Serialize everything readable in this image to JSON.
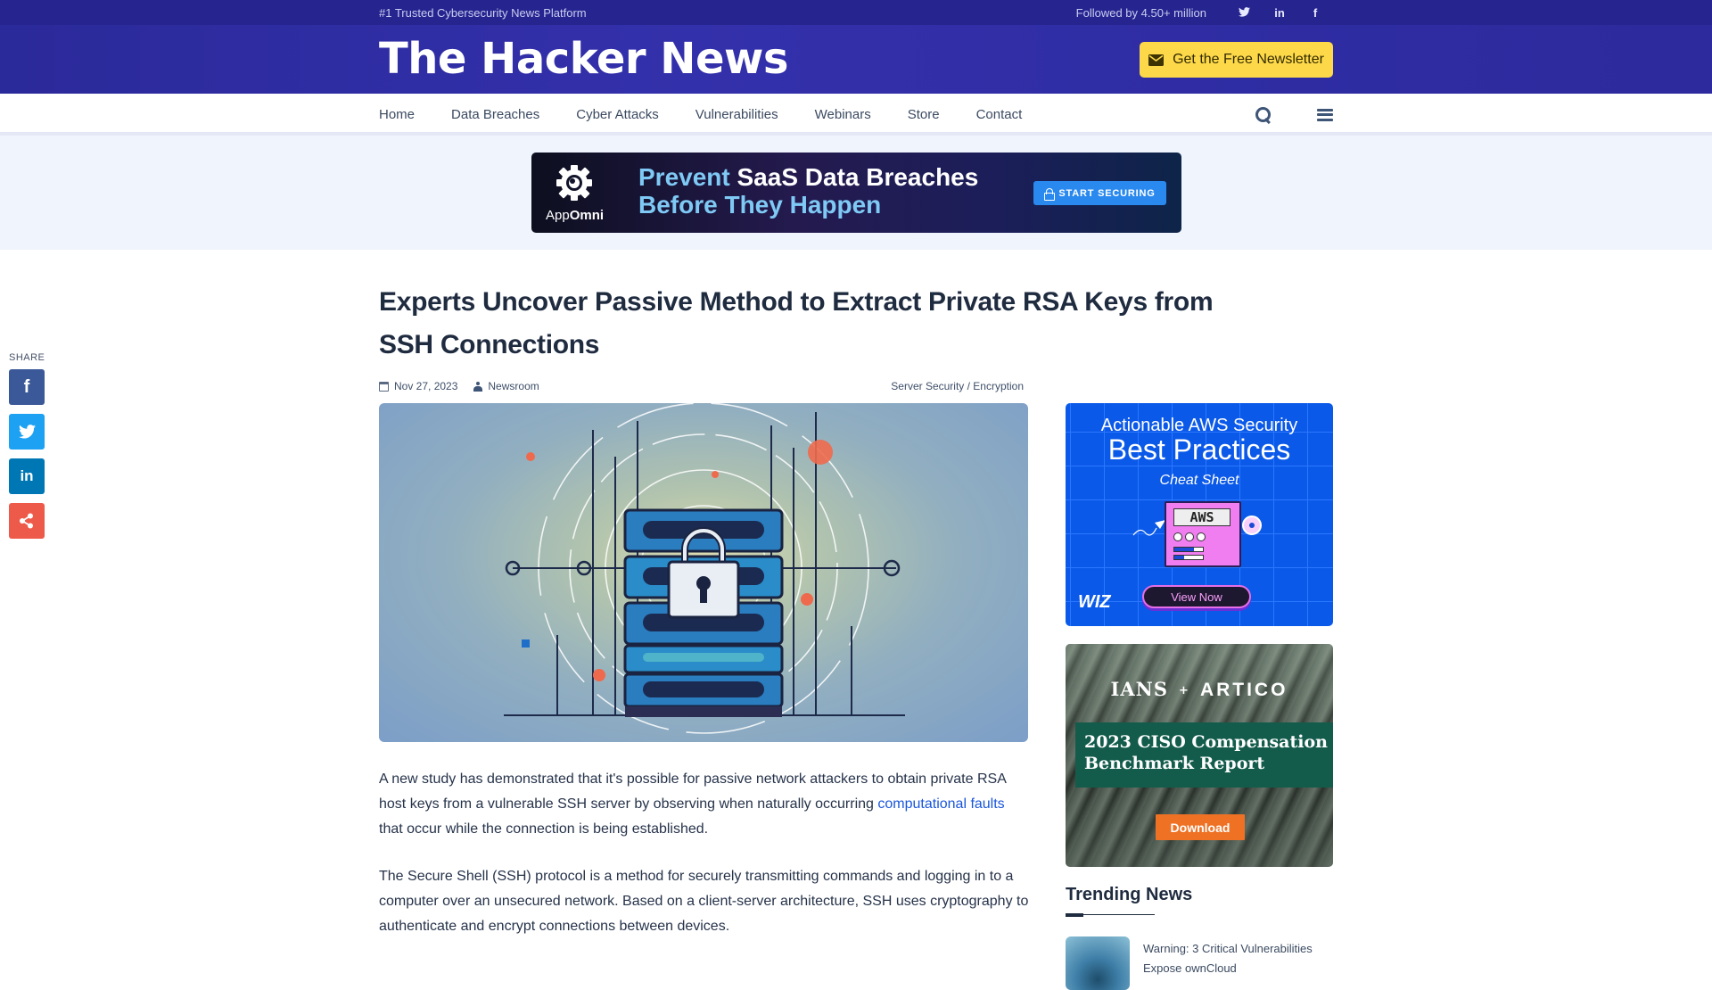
{
  "topbar": {
    "tagline": "#1 Trusted Cybersecurity News Platform",
    "followed": "Followed by 4.50+ million",
    "social": [
      {
        "name": "twitter-icon",
        "glyph": "🐦"
      },
      {
        "name": "linkedin-icon",
        "glyph": "in"
      },
      {
        "name": "facebook-icon",
        "glyph": "f"
      }
    ]
  },
  "header": {
    "logo": "The Hacker News",
    "newsletter_label": "Get the Free Newsletter"
  },
  "nav": {
    "items": [
      "Home",
      "Data Breaches",
      "Cyber Attacks",
      "Vulnerabilities",
      "Webinars",
      "Store",
      "Contact"
    ]
  },
  "top_ad": {
    "brand_prefix": "App",
    "brand_suffix": "Omni",
    "line1_highlight": "Prevent",
    "line1_rest": " SaaS Data Breaches",
    "line2": "Before They Happen",
    "cta": "START SECURING"
  },
  "share": {
    "label": "SHARE",
    "buttons": [
      {
        "name": "facebook",
        "glyph": "f"
      },
      {
        "name": "twitter",
        "glyph": "🐦"
      },
      {
        "name": "linkedin",
        "glyph": "in"
      },
      {
        "name": "share",
        "glyph": "⋖"
      }
    ]
  },
  "article": {
    "title": "Experts Uncover Passive Method to Extract Private RSA Keys from SSH Connections",
    "date": "Nov 27, 2023",
    "author": "Newsroom",
    "category": "Server Security / Encryption",
    "paragraphs": [
      {
        "before": "A new study has demonstrated that it's possible for passive network attackers to obtain private RSA host keys from a vulnerable SSH server by observing when naturally occurring ",
        "link": "computational faults",
        "after": " that occur while the connection is being established."
      },
      {
        "text": "The Secure Shell (SSH) protocol is a method for securely transmitting commands and logging in to a computer over an unsecured network. Based on a client-server architecture, SSH uses cryptography to authenticate and encrypt connections between devices."
      }
    ]
  },
  "sidebar": {
    "wiz_ad": {
      "line1": "Actionable AWS Security",
      "line2": "Best Practices",
      "line3": "Cheat Sheet",
      "screen": "AWS",
      "logo": "WIZ",
      "cta": "View Now"
    },
    "ians_ad": {
      "logo1": "IANS",
      "plus": "+",
      "logo2": "ARTICO",
      "title": "2023 CISO Compensation Benchmark Report",
      "cta": "Download"
    },
    "trending": {
      "heading": "Trending News",
      "items": [
        {
          "title": "Warning: 3 Critical Vulnerabilities Expose ownCloud"
        }
      ]
    }
  }
}
